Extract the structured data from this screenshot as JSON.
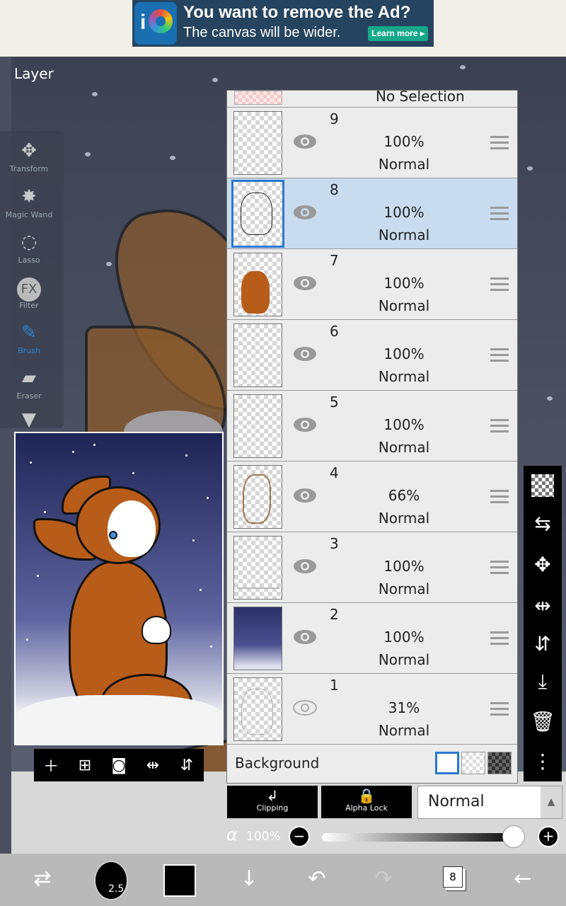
{
  "ad": {
    "title": "You want to remove the Ad?",
    "subtitle": "The canvas will be wider.",
    "button": "Learn more ▸"
  },
  "canvas": {
    "panel_title": "Layer"
  },
  "tools": [
    {
      "label": "Transform",
      "icon": "✥"
    },
    {
      "label": "Magic Wand",
      "icon": "✸"
    },
    {
      "label": "Lasso",
      "icon": "◌"
    },
    {
      "label": "Filter",
      "icon": "FX"
    },
    {
      "label": "Brush",
      "icon": "✎"
    },
    {
      "label": "Eraser",
      "icon": "▰"
    },
    {
      "label": "",
      "icon": "▼"
    }
  ],
  "layers_panel": {
    "top_label": "No Selection",
    "layers": [
      {
        "num": "9",
        "opacity": "100%",
        "mode": "Normal"
      },
      {
        "num": "8",
        "opacity": "100%",
        "mode": "Normal"
      },
      {
        "num": "7",
        "opacity": "100%",
        "mode": "Normal"
      },
      {
        "num": "6",
        "opacity": "100%",
        "mode": "Normal"
      },
      {
        "num": "5",
        "opacity": "100%",
        "mode": "Normal"
      },
      {
        "num": "4",
        "opacity": "66%",
        "mode": "Normal"
      },
      {
        "num": "3",
        "opacity": "100%",
        "mode": "Normal"
      },
      {
        "num": "2",
        "opacity": "100%",
        "mode": "Normal"
      },
      {
        "num": "1",
        "opacity": "31%",
        "mode": "Normal"
      }
    ],
    "background_label": "Background"
  },
  "controls": {
    "clipping": "Clipping",
    "alpha_lock": "Alpha Lock",
    "blend_mode": "Normal",
    "alpha_symbol": "α",
    "opacity": "100%",
    "opacity_level": 0.95
  },
  "bottom": {
    "brush_size": "2.5",
    "layer_count": "8",
    "current_color": "#000000"
  },
  "colors": {
    "selected_layer": "#c9dcef",
    "accent": "#2b78d0"
  }
}
